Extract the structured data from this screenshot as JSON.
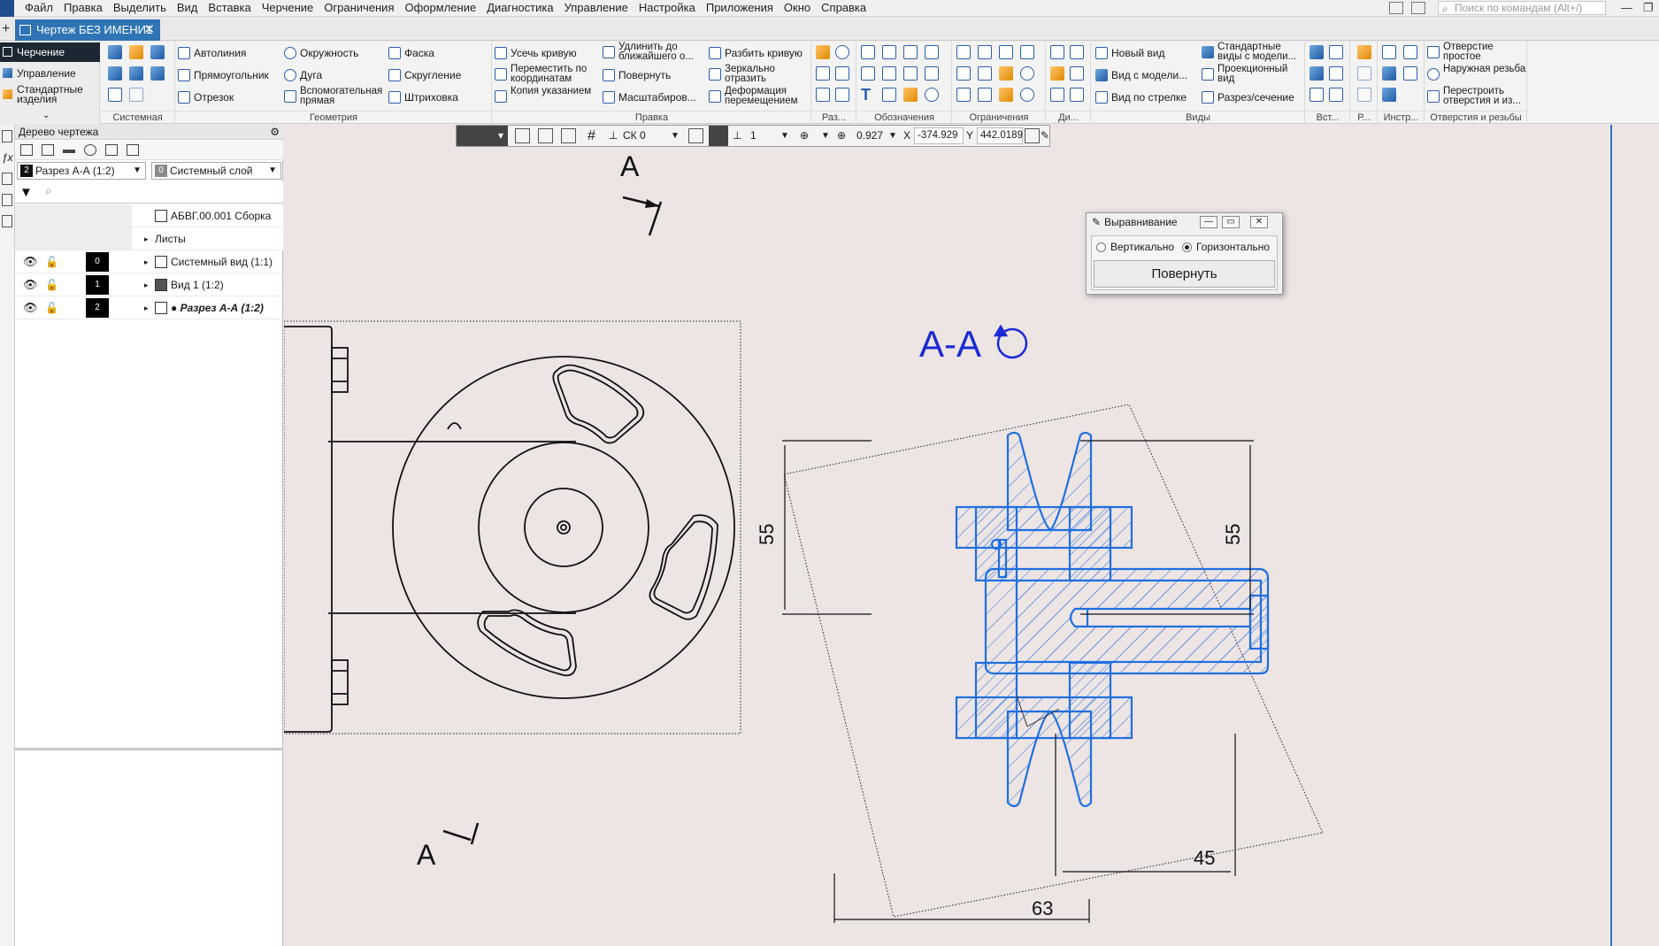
{
  "menu": [
    "Файл",
    "Правка",
    "Выделить",
    "Вид",
    "Вставка",
    "Черчение",
    "Ограничения",
    "Оформление",
    "Диагностика",
    "Управление",
    "Настройка",
    "Приложения",
    "Окно",
    "Справка"
  ],
  "command_search": {
    "placeholder": "Поиск по командам (Alt+/)"
  },
  "document_tab": {
    "title": "Чертеж БЕЗ ИМЕНИ1",
    "close": "✕"
  },
  "ribbon": {
    "left_tabs": [
      "Черчение",
      "Управление",
      "Стандартные изделия"
    ],
    "groups": {
      "system": "Системная",
      "geometry": "Геометрия",
      "edit": "Правка",
      "dims": "Раз...",
      "designations": "Обозначения",
      "constraints": "Ограничения",
      "di": "Ди...",
      "views": "Виды",
      "vst": "Вст...",
      "r": "Р...",
      "instr": "Инстр...",
      "holes": "Отверстия и резьбы"
    },
    "geometry_buttons": [
      "Автолиния",
      "Прямоугольник",
      "Отрезок",
      "Окружность",
      "Дуга",
      "Вспомогательная прямая",
      "Фаска",
      "Скругление",
      "Штриховка"
    ],
    "edit_buttons": [
      "Усечь кривую",
      "Переместить по координатам",
      "Копия указанием",
      "Удлинить до ближайшего о...",
      "Повернуть",
      "Масштабиров...",
      "Разбить кривую",
      "Зеркально отразить",
      "Деформация перемещением"
    ],
    "view_buttons": [
      "Новый вид",
      "Вид с модели...",
      "Вид по стрелке",
      "Стандартные виды с модели...",
      "Проекционный вид",
      "Разрез/сечение"
    ],
    "hole_buttons": [
      "Отверстие простое",
      "Наружная резьба",
      "Перестроить отверстия и из..."
    ]
  },
  "tree": {
    "title": "Дерево чертежа",
    "view_combo": {
      "num": "2",
      "label": "Разрез А-А (1:2)"
    },
    "layer_combo": {
      "num": "0",
      "label": "Системный слой"
    },
    "rows": [
      {
        "text": "АБВГ.00.001 Сборка"
      },
      {
        "text": "Листы"
      },
      {
        "num": "0",
        "text": "Системный вид (1:1)"
      },
      {
        "num": "1",
        "text": "Вид 1 (1:2)"
      },
      {
        "num": "2",
        "text": "● Разрез А-А (1:2)"
      }
    ]
  },
  "float_toolbar": {
    "cs": "СК 0",
    "step": "1",
    "zoom": "0.927",
    "x_label": "X",
    "x": "-374.929",
    "y_label": "Y",
    "y": "442.0189"
  },
  "align_dialog": {
    "title": "Выравнивание",
    "vertical": "Вертикально",
    "horizontal": "Горизонтально",
    "selected": "horizontal",
    "button": "Повернуть"
  },
  "drawing": {
    "section_label_top": "А",
    "section_label_bottom": "А",
    "section_title": "А-А",
    "dims": {
      "d55_left": "55",
      "d55_right": "55",
      "d45": "45",
      "d63": "63"
    },
    "colors": {
      "outline": "#111111",
      "section": "#1f6fe0",
      "label": "#1a2ad6",
      "accent": "#2f74b5"
    }
  }
}
